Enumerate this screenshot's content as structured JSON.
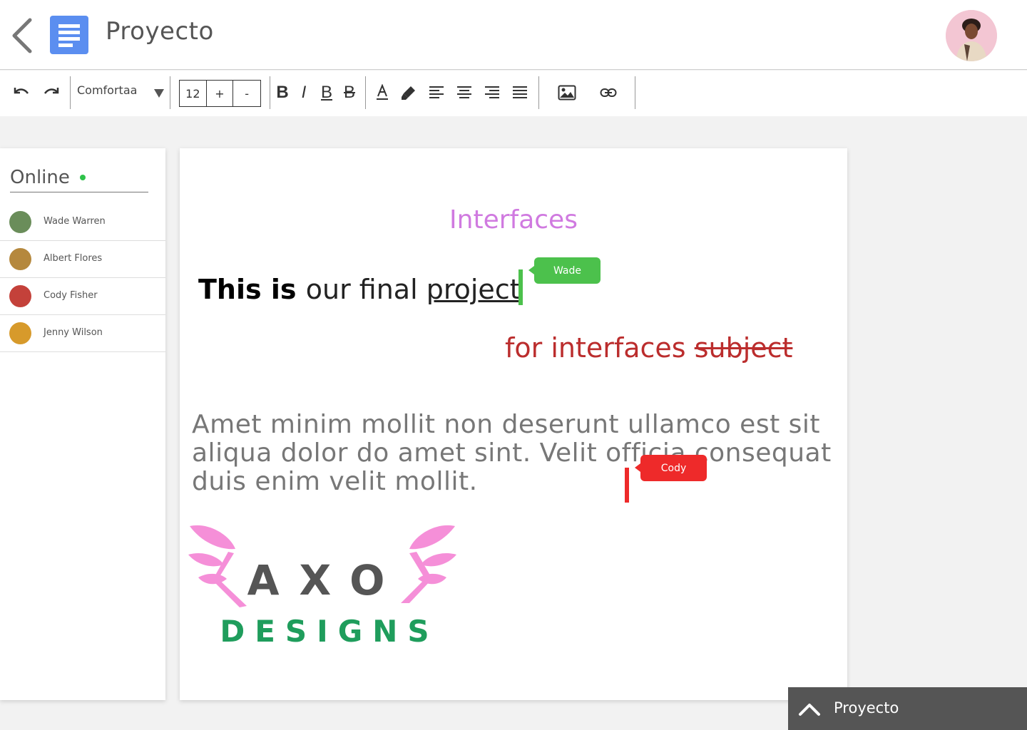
{
  "header": {
    "title": "Proyecto",
    "back_icon": "chevron-left-icon",
    "doc_icon": "document-icon"
  },
  "toolbar": {
    "font_name": "Comfortaa",
    "font_size": "12",
    "plus": "+",
    "minus": "-",
    "bold": "B",
    "italic": "I",
    "underline": "B",
    "strike": "B"
  },
  "online": {
    "title": "Online",
    "users": [
      {
        "name": "Wade Warren",
        "color": "#6a8d5a"
      },
      {
        "name": "Albert Flores",
        "color": "#b5883d"
      },
      {
        "name": "Cody Fisher",
        "color": "#c4413a"
      },
      {
        "name": "Jenny Wilson",
        "color": "#d79a2b"
      }
    ]
  },
  "document": {
    "heading": "Interfaces",
    "line1_bold": "This is ",
    "line1_plain": " our final ",
    "line1_underline": "project",
    "line2_plain": "for interfaces ",
    "line2_strike": "subject",
    "paragraph": "Amet minim mollit non deserunt ullamco est sit aliqua dolor do amet sint. Velit officia consequat duis enim velit mollit.",
    "cursor_tags": {
      "wade": "Wade",
      "cody": "Cody"
    },
    "logo_top": "AXO",
    "logo_bottom": "DESIGNS"
  },
  "bottom_bar": {
    "label": "Proyecto"
  },
  "colors": {
    "heading": "#d07ae0",
    "wade": "#4cc14c",
    "cody": "#ee2a2a",
    "online": "#2ec24a",
    "logo_green": "#1f9d5c",
    "logo_pink": "#f58fd8"
  }
}
